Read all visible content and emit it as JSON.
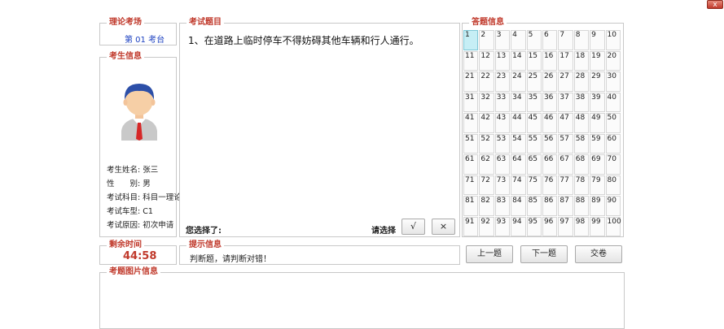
{
  "window": {
    "close_label": "x"
  },
  "exam_center": {
    "legend": "理论考场",
    "value": "第 01 考台"
  },
  "candidate": {
    "legend": "考生信息",
    "lines": [
      "考生姓名: 张三",
      "性　　别: 男",
      "考试科目: 科目一理论",
      "考试车型: C1",
      "考试原因: 初次申请"
    ]
  },
  "question": {
    "legend": "考试题目",
    "text": "1、在道路上临时停车不得妨碍其他车辆和行人通行。",
    "you_chose_label": "您选择了:",
    "please_choose_label": "请选择",
    "true_label": "√",
    "false_label": "×"
  },
  "answer_sheet": {
    "legend": "答题信息",
    "numbers": [
      "1",
      "2",
      "3",
      "4",
      "5",
      "6",
      "7",
      "8",
      "9",
      "10",
      "11",
      "12",
      "13",
      "14",
      "15",
      "16",
      "17",
      "18",
      "19",
      "20",
      "21",
      "22",
      "23",
      "24",
      "25",
      "26",
      "27",
      "28",
      "29",
      "30",
      "31",
      "32",
      "33",
      "34",
      "35",
      "36",
      "37",
      "38",
      "39",
      "40",
      "41",
      "42",
      "43",
      "44",
      "45",
      "46",
      "47",
      "48",
      "49",
      "50",
      "51",
      "52",
      "53",
      "54",
      "55",
      "56",
      "57",
      "58",
      "59",
      "60",
      "61",
      "62",
      "63",
      "64",
      "65",
      "66",
      "67",
      "68",
      "69",
      "70",
      "71",
      "72",
      "73",
      "74",
      "75",
      "76",
      "77",
      "78",
      "79",
      "80",
      "81",
      "82",
      "83",
      "84",
      "85",
      "86",
      "87",
      "88",
      "89",
      "90",
      "91",
      "92",
      "93",
      "94",
      "95",
      "96",
      "97",
      "98",
      "99",
      "100"
    ],
    "active": "1"
  },
  "timer": {
    "legend": "剩余时间",
    "value": "44:58"
  },
  "tips": {
    "legend": "提示信息",
    "text": "判断题，请判断对错！"
  },
  "nav": {
    "prev_label": "上一题",
    "next_label": "下一题",
    "submit_label": "交卷"
  },
  "image_info": {
    "legend": "考题图片信息"
  },
  "colors": {
    "legend_red": "#c0392b",
    "exam_center_blue": "#1a3fc0",
    "active_cell": "#c6eef5"
  }
}
